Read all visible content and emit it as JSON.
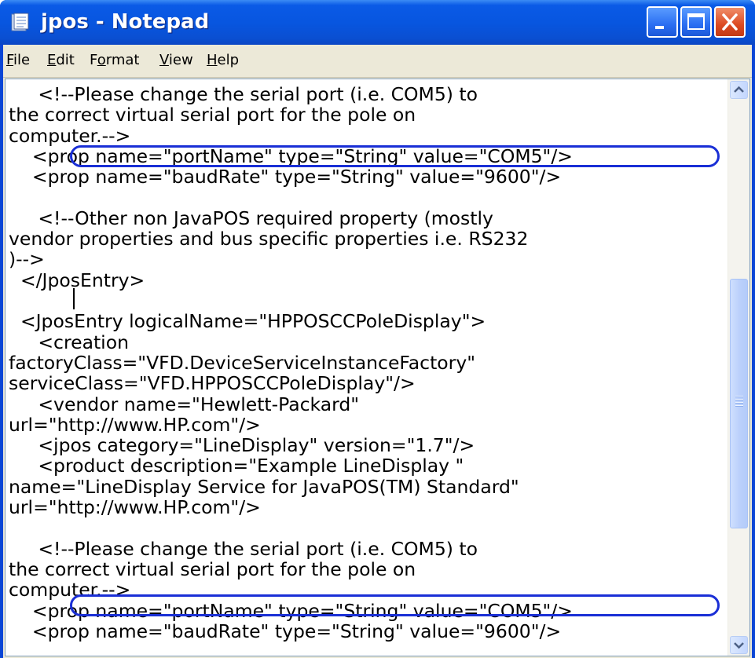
{
  "window": {
    "title": "jpos - Notepad"
  },
  "menu": [
    {
      "label": "File",
      "accel": "F",
      "rest": "ile"
    },
    {
      "label": "Edit",
      "accel": "E",
      "rest": "dit"
    },
    {
      "label": "Format",
      "pre": "F",
      "accel": "o",
      "rest": "rmat"
    },
    {
      "label": "View",
      "accel": "V",
      "rest": "iew"
    },
    {
      "label": "Help",
      "accel": "H",
      "rest": "elp"
    }
  ],
  "editor": {
    "lines": [
      "     <!--Please change the serial port (i.e. COM5) to",
      "the correct virtual serial port for the pole on",
      "computer.-->",
      "    <prop name=\"portName\" type=\"String\" value=\"COM5\"/>",
      "    <prop name=\"baudRate\" type=\"String\" value=\"9600\"/>",
      "",
      "     <!--Other non JavaPOS required property (mostly",
      "vendor properties and bus specific properties i.e. RS232",
      ")-->",
      "  </JposEntry>",
      "",
      "  <JposEntry logicalName=\"HPPOSCCPoleDisplay\">",
      "     <creation",
      "factoryClass=\"VFD.DeviceServiceInstanceFactory\"",
      "serviceClass=\"VFD.HPPOSCCPoleDisplay\"/>",
      "     <vendor name=\"Hewlett-Packard\"",
      "url=\"http://www.HP.com\"/>",
      "     <jpos category=\"LineDisplay\" version=\"1.7\"/>",
      "     <product description=\"Example LineDisplay \"",
      "name=\"LineDisplay Service for JavaPOS(TM) Standard\"",
      "url=\"http://www.HP.com\"/>",
      "",
      "     <!--Please change the serial port (i.e. COM5) to",
      "the correct virtual serial port for the pole on",
      "computer.-->",
      "    <prop name=\"portName\" type=\"String\" value=\"COM5\"/>",
      "    <prop name=\"baudRate\" type=\"String\" value=\"9600\"/>"
    ]
  },
  "annotation": {
    "color": "#1a2fd6"
  },
  "icons": {
    "app": "notepad-icon",
    "minimize": "minimize-icon",
    "maximize": "maximize-icon",
    "close": "close-icon",
    "scroll_up": "arrow-up-icon",
    "scroll_down": "arrow-down-icon"
  }
}
